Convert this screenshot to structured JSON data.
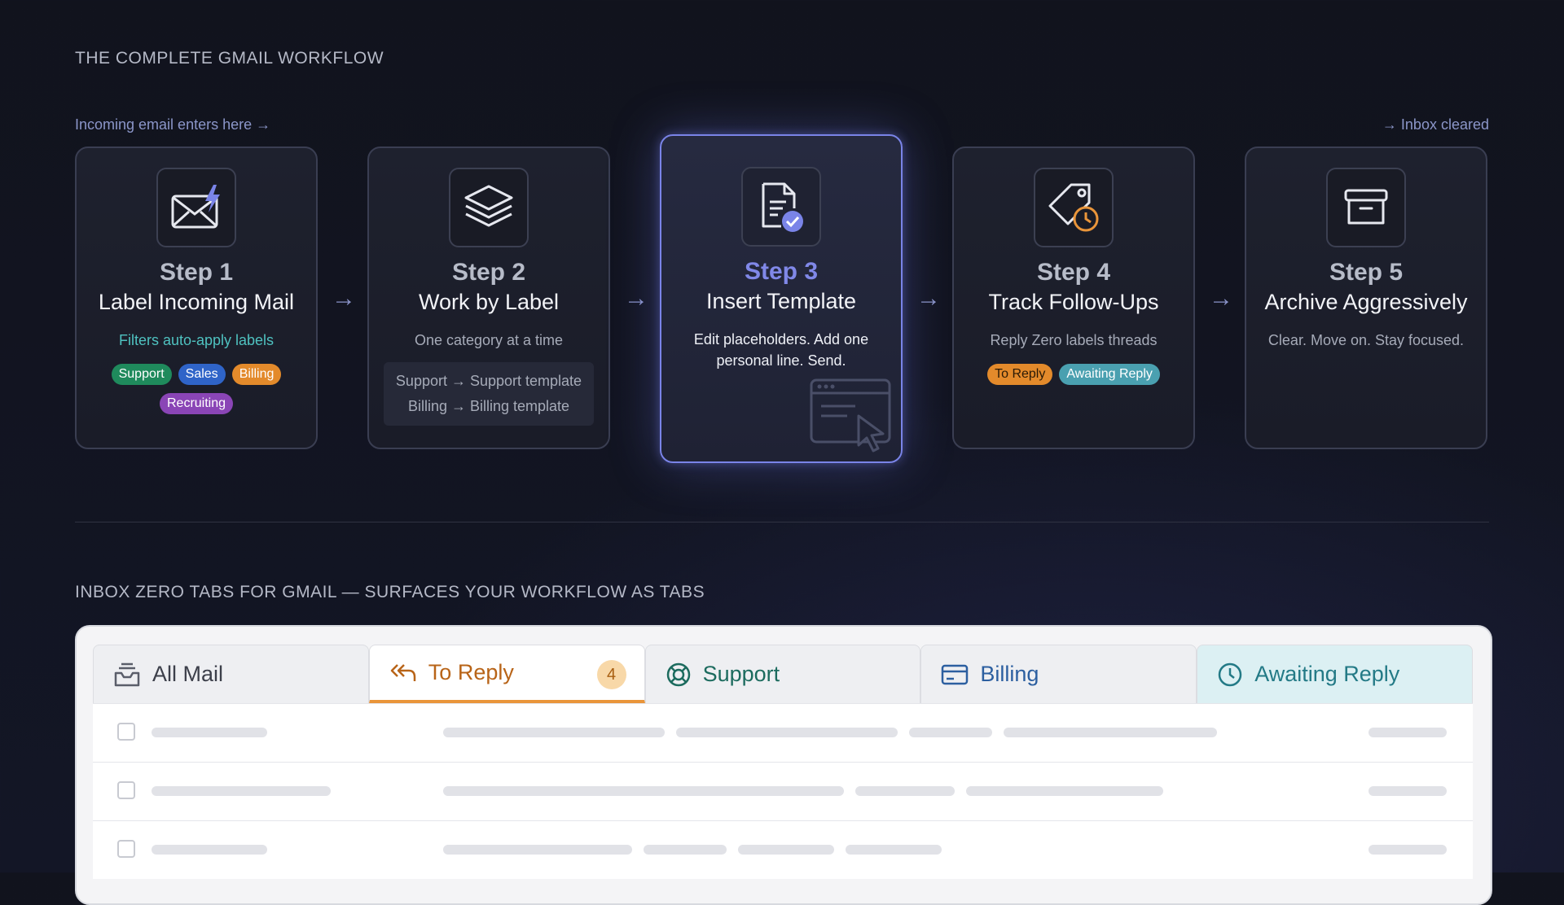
{
  "workflow": {
    "title": "THE COMPLETE GMAIL WORKFLOW",
    "entry_note": "Incoming email enters here →",
    "exit_note": "→ Inbox cleared",
    "steps": [
      {
        "num": "Step 1",
        "name": "Label Incoming Mail",
        "desc": "Filters auto-apply labels",
        "icon": "envelope-bolt-icon",
        "chips": [
          "Support",
          "Sales",
          "Billing",
          "Recruiting"
        ]
      },
      {
        "num": "Step 2",
        "name": "Work by Label",
        "desc": "One category at a time",
        "icon": "layers-icon",
        "rules": [
          "Support → Support template",
          "Billing → Billing template"
        ]
      },
      {
        "num": "Step 3",
        "name": "Insert Template",
        "desc": "Edit placeholders. Add one personal line. Send.",
        "icon": "document-check-icon"
      },
      {
        "num": "Step 4",
        "name": "Track Follow-Ups",
        "desc": "Reply Zero labels threads",
        "icon": "tag-clock-icon",
        "chips": [
          "To Reply",
          "Awaiting Reply"
        ]
      },
      {
        "num": "Step 5",
        "name": "Archive Aggressively",
        "desc": "Clear. Move on. Stay focused.",
        "icon": "archive-box-icon"
      }
    ]
  },
  "colors": {
    "support": "#1f8a5c",
    "sales": "#2f64c8",
    "billing": "#e38a2b",
    "recruiting": "#8a45b6",
    "to_reply": "#e38a2b",
    "awaiting_reply": "#4aa0b0",
    "accent": "#7a84e8"
  },
  "tabs_section": {
    "title": "INBOX ZERO TABS FOR GMAIL — SURFACES YOUR WORKFLOW AS TABS",
    "tabs": [
      {
        "label": "All Mail",
        "icon": "inbox-tray-icon"
      },
      {
        "label": "To Reply",
        "icon": "reply-all-icon",
        "badge": "4"
      },
      {
        "label": "Support",
        "icon": "lifebuoy-icon"
      },
      {
        "label": "Billing",
        "icon": "credit-card-icon"
      },
      {
        "label": "Awaiting Reply",
        "icon": "clock-icon"
      }
    ],
    "active_tab": "To Reply"
  }
}
